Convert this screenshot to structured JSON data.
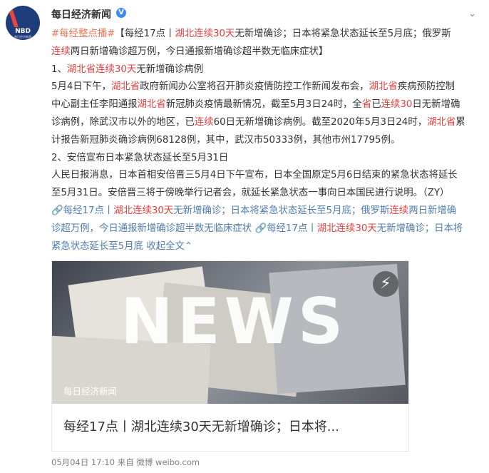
{
  "header": {
    "avatar_text": "NBD",
    "avatar_subtext": "每日经济新闻",
    "username": "每日经济新闻",
    "verified_badge": "V",
    "more_icon": "chevron-down-icon"
  },
  "post": {
    "line1": {
      "hashtag": "#每经整点播#",
      "t1": "【每经17点丨",
      "hl1": "湖北连续30天",
      "t2": "无新增确诊；日本将紧急状态延长至5月底；俄罗斯"
    },
    "line2": {
      "hl1": "连续",
      "t1": "两日新增确诊超万例，今日通报新增确诊超半数无临床症状】"
    },
    "line3": {
      "t1": "1、",
      "hl1": "湖北省连续30天",
      "t2": "无新增确诊病例"
    },
    "line4": {
      "t1": "5月4日下午，",
      "hl1": "湖北省",
      "t2": "政府新闻办公室将召开肺炎疫情防控工作新闻发布会，",
      "hl2": "湖北省",
      "t3": "疾病预防控制"
    },
    "line5": {
      "t1": "中心副主任李阳通报",
      "hl1": "湖北省",
      "t2": "新冠肺炎疫情最新情况，截至5月3日24时，全",
      "hl2": "省",
      "t3": "已",
      "hl3": "连续30",
      "t4": "日无新增确"
    },
    "line6": {
      "t1": "诊病例，除武汉市以外的地区，已",
      "hl1": "连续",
      "t2": "60日无新增确诊病例。截至2020年5月3日24时，",
      "hl2": "湖北省",
      "t3": "累"
    },
    "line7": "计报告新冠肺炎确诊病例68128例，其中，武汉市50333例，其他市州17795例。",
    "line8": "2、安倍宣布日本紧急状态延长至5月31日",
    "line9": "人民日报消息，日本首相安倍晋三5月4日下午宣布，日本全国原定5月6日结束的紧急状态将延长",
    "line10": "至5月31日。安倍晋三将于傍晚举行记者会，就延长紧急状态一事向日本国民进行说明。（ZY）",
    "line11": {
      "a1": "每经17点丨",
      "hl1": "湖北连续30天",
      "a2": "无新增确诊；日本将紧急状态延长至5月底；俄罗斯",
      "hl2": "连续",
      "a3": "两日新增确"
    },
    "line12": {
      "a1": "诊超万例，今日通报新增确诊超半数无临床症状",
      "b1": "每经17点丨",
      "hl1": "湖北连续30天",
      "b2": "无新增确诊；日本将"
    },
    "line13": {
      "a1": "紧急状态延长至5月底",
      "collapse": "收起全文"
    }
  },
  "card": {
    "image_text": "NEWS",
    "image_caption": "每日经济新闻",
    "flash_icon": "lightning-icon",
    "title": "每经17点丨湖北连续30天无新增确诊；日本将..."
  },
  "footer": {
    "date": "05月04日 17:10",
    "from_label": "来自",
    "source": "微博 weibo.com"
  },
  "colors": {
    "hashtag": "#eb7350",
    "link": "#507daf",
    "highlight": "#e24040",
    "text": "#333333",
    "meta": "#808080"
  }
}
